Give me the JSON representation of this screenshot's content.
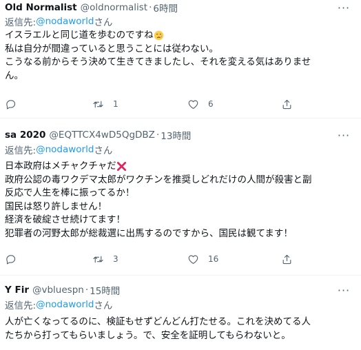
{
  "tweets": [
    {
      "name": "Old Normalist",
      "handle": "@oldnormalist",
      "separator": "·",
      "time": "6時間",
      "more": "···",
      "reply_prefix": "返信先: ",
      "reply_mention": "@nodaworld",
      "reply_suffix": "さん",
      "lines": [
        "イスラエルと同じ道を歩むのですね",
        "私は自分が間違っていると思うことには従わない。",
        "こうなる前からそう決めて生きてきましたし、それを変える気はありませ",
        "ん。"
      ],
      "emoji": "crying-face-icon",
      "replies": "",
      "retweets": "1",
      "likes": "6"
    },
    {
      "name": "sa 2020",
      "handle": "@EQTTCX4wD5QgDBZ",
      "separator": "·",
      "time": "13時間",
      "more": "···",
      "reply_prefix": "返信先: ",
      "reply_mention": "@nodaworld",
      "reply_suffix": "さん",
      "lines": [
        "日本政府はメチャクチャだ",
        "政府公認の毒ワクデマ太郎がワクチンを推奨しどれだけの人間が殺害と副",
        "反応で人生を棒に振ってるか！",
        "国民は怒り許しません！",
        "経済を破綻させ続けてます！",
        "犯罪者の河野太郎が総裁選に出馬するのですから、国民は観てます！"
      ],
      "emoji": "cross-mark-icon",
      "replies": "",
      "retweets": "3",
      "likes": "16"
    },
    {
      "name": "Y Fir",
      "handle": "@vbluespn",
      "separator": "·",
      "time": "15時間",
      "more": "···",
      "reply_prefix": "返信先: ",
      "reply_mention": "@nodaworld",
      "reply_suffix": "さん",
      "lines": [
        "人が亡くなってるのに、検証もせずどんどん打たせる。これを決めてる人",
        "たちから打ってもらいましょう。で、安全を証明してもらわないと。"
      ]
    }
  ],
  "colors": {
    "text": "#0f1419",
    "secondary": "#536471",
    "link": "#1d9bf0",
    "divider": "#eff3f4",
    "cross_mark": "#e0245e"
  }
}
